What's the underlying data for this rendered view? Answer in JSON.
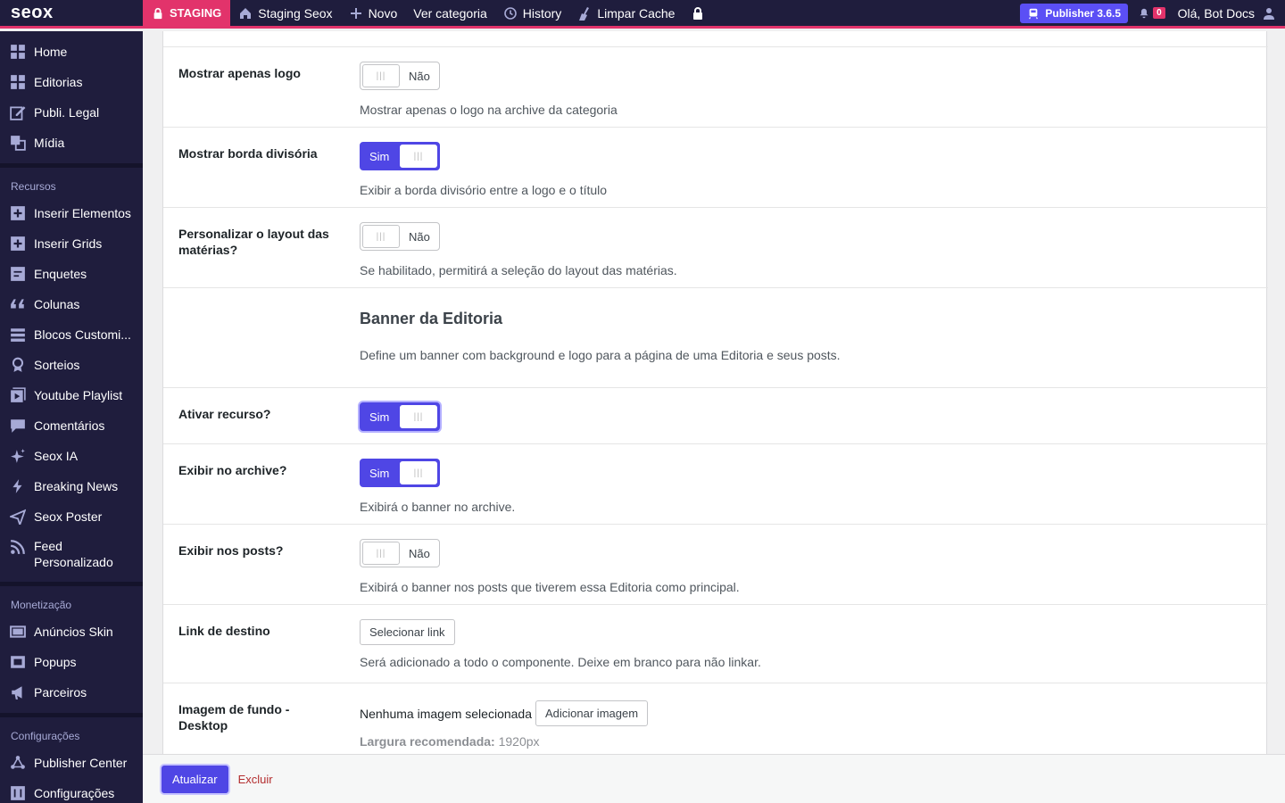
{
  "adminbar": {
    "logo": "seox",
    "staging": "STAGING",
    "site": "Staging Seox",
    "new": "Novo",
    "view_category": "Ver categoria",
    "history": "History",
    "clear_cache": "Limpar Cache",
    "publisher": "Publisher 3.6.5",
    "notifications": "0",
    "greeting": "Olá, Bot Docs"
  },
  "sidebar": {
    "main": [
      "Home",
      "Editorias",
      "Publi. Legal",
      "Mídia"
    ],
    "resources_title": "Recursos",
    "resources": [
      "Inserir Elementos",
      "Inserir Grids",
      "Enquetes",
      "Colunas",
      "Blocos Customi...",
      "Sorteios",
      "Youtube Playlist",
      "Comentários",
      "Seox IA",
      "Breaking News",
      "Seox Poster",
      "Feed Personalizado"
    ],
    "monetization_title": "Monetização",
    "monetization": [
      "Anúncios Skin",
      "Popups",
      "Parceiros"
    ],
    "settings_title": "Configurações",
    "settings": [
      "Publisher Center",
      "Configurações"
    ]
  },
  "form": {
    "logo_only": {
      "label": "Mostrar apenas logo",
      "toggle": "Não",
      "desc": "Mostrar apenas o logo na archive da categoria"
    },
    "border": {
      "label": "Mostrar borda divisória",
      "toggle": "Sim",
      "desc": "Exibir a borda divisório entre a logo e o título"
    },
    "layout": {
      "label": "Personalizar o layout das matérias?",
      "toggle": "Não",
      "desc": "Se habilitado, permitirá a seleção do layout das matérias."
    },
    "banner": {
      "heading": "Banner da Editoria",
      "desc": "Define um banner com background e logo para a página de uma Editoria e seus posts."
    },
    "activate": {
      "label": "Ativar recurso?",
      "toggle": "Sim"
    },
    "archive": {
      "label": "Exibir no archive?",
      "toggle": "Sim",
      "desc": "Exibirá o banner no archive."
    },
    "posts": {
      "label": "Exibir nos posts?",
      "toggle": "Não",
      "desc": "Exibirá o banner nos posts que tiverem essa Editoria como principal."
    },
    "link": {
      "label": "Link de destino",
      "button": "Selecionar link",
      "desc": "Será adicionado a todo o componente. Deixe em branco para não linkar."
    },
    "image": {
      "label": "Imagem de fundo - Desktop",
      "none": "Nenhuma imagem selecionada",
      "button": "Adicionar imagem",
      "rec_label": "Largura recomendada:",
      "rec_value": "1920px"
    }
  },
  "footer": {
    "update": "Atualizar",
    "delete": "Excluir"
  },
  "colors": {
    "accent": "#4f46e5",
    "brand_pink": "#e2336b",
    "sidebar_bg": "#1f1d3d"
  }
}
